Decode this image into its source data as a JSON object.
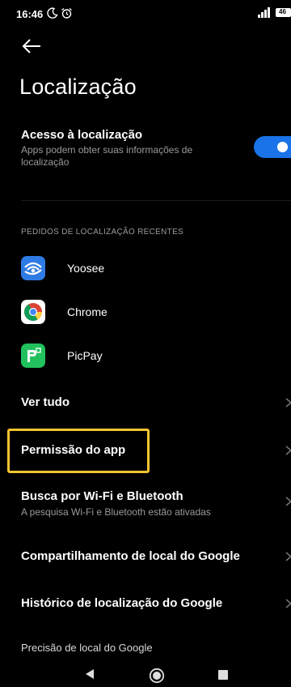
{
  "status": {
    "time": "16:46",
    "battery": "46",
    "moon_icon": "moon-icon",
    "alarm_icon": "alarm-clock-icon"
  },
  "header": {
    "title": "Localização",
    "back_icon": "arrow-left-icon"
  },
  "access": {
    "title": "Acesso à localização",
    "description": "Apps podem obter suas informações de localização",
    "enabled": true,
    "accent": "#1a73e8"
  },
  "recent": {
    "header": "PEDIDOS DE LOCALIZAÇÃO RECENTES",
    "apps": [
      {
        "label": "Yoosee",
        "icon": "yoosee-app-icon"
      },
      {
        "label": "Chrome",
        "icon": "chrome-app-icon"
      },
      {
        "label": "PicPay",
        "icon": "picpay-app-icon"
      }
    ]
  },
  "items": {
    "see_all": "Ver tudo",
    "app_permission": "Permissão do app",
    "wifi_bt": "Busca por Wi-Fi e Bluetooth",
    "wifi_bt_sub": "A pesquisa Wi-Fi e Bluetooth estão ativadas",
    "google_sharing": "Compartilhamento de local do Google",
    "google_history": "Histórico de localização do Google",
    "google_accuracy": "Precisão de local do Google"
  },
  "highlight_color": "#f5c430"
}
